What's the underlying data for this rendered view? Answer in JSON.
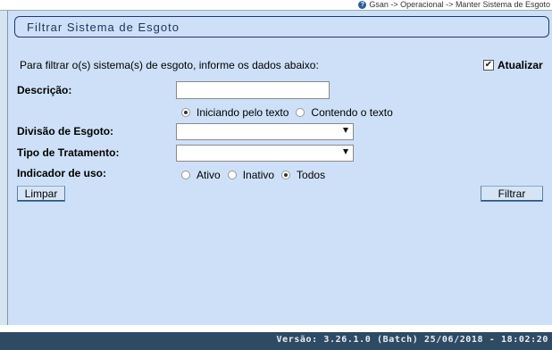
{
  "breadcrumb": "Gsan -> Operacional -> Manter Sistema de Esgoto",
  "page_title": "Filtrar Sistema de Esgoto",
  "intro": "Para filtrar o(s) sistema(s) de esgoto, informe os dados abaixo:",
  "atualizar": {
    "label": "Atualizar",
    "checked": true
  },
  "descricao": {
    "label": "Descrição:",
    "value": ""
  },
  "match_mode": {
    "options": [
      "Iniciando pelo texto",
      "Contendo o texto"
    ],
    "selected": "Iniciando pelo texto"
  },
  "divisao": {
    "label": "Divisão de Esgoto:",
    "value": ""
  },
  "tratamento": {
    "label": "Tipo de Tratamento:",
    "value": ""
  },
  "indicador_uso": {
    "label": "Indicador de uso:",
    "options": [
      "Ativo",
      "Inativo",
      "Todos"
    ],
    "selected": "Todos"
  },
  "buttons": {
    "limpar": "Limpar",
    "filtrar": "Filtrar"
  },
  "version": "Versão: 3.26.1.0 (Batch) 25/06/2018 - 18:02:20",
  "colors": {
    "panel_bg": "#cde0f7",
    "footer_bg": "#2f4a63",
    "title_border": "#1e3a6b"
  }
}
